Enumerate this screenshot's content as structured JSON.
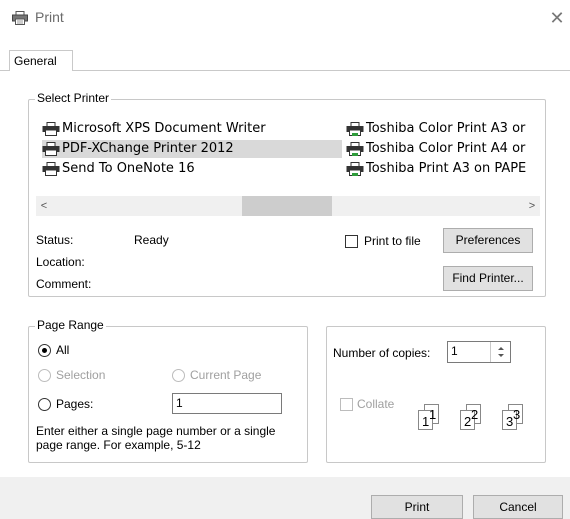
{
  "window": {
    "title": "Print",
    "close_glyph": "✕"
  },
  "tabs": [
    {
      "label": "General"
    }
  ],
  "select_printer": {
    "legend": "Select Printer",
    "printers_left": [
      {
        "name": "Microsoft XPS Document Writer",
        "icon": "printer-icon"
      },
      {
        "name": "PDF-XChange Printer 2012",
        "icon": "printer-icon",
        "selected": true
      },
      {
        "name": "Send To OneNote 16",
        "icon": "printer-icon"
      }
    ],
    "printers_right": [
      {
        "name": "Toshiba Color Print A3 or",
        "icon": "network-printer-icon"
      },
      {
        "name": "Toshiba Color Print A4 or",
        "icon": "network-printer-icon"
      },
      {
        "name": "Toshiba Print A3 on PAPE",
        "icon": "network-printer-icon"
      }
    ],
    "scroll_left": "<",
    "scroll_right": ">",
    "status_label": "Status:",
    "status_value": "Ready",
    "location_label": "Location:",
    "comment_label": "Comment:",
    "print_to_file_label": "Print to file",
    "preferences_label": "Preferences",
    "find_printer_label": "Find Printer..."
  },
  "page_range": {
    "legend": "Page Range",
    "all_label": "All",
    "selection_label": "Selection",
    "current_page_label": "Current Page",
    "pages_label": "Pages:",
    "pages_value": "1",
    "hint": "Enter either a single page number or a single page range.  For example, 5-12"
  },
  "copies": {
    "label": "Number of copies:",
    "value": "1",
    "collate_label": "Collate",
    "collate_pages": [
      "1",
      "1",
      "2",
      "2",
      "3",
      "3"
    ]
  },
  "footer": {
    "print_label": "Print",
    "cancel_label": "Cancel"
  }
}
